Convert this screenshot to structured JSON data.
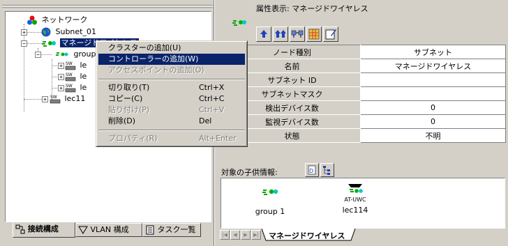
{
  "tree": {
    "root": "ネットワーク",
    "subnet": "Subnet_01",
    "managed_wireless": "マネージドワイヤレス",
    "group": "group",
    "le1": "le",
    "le2": "le",
    "le3": "le",
    "lec": "lec11"
  },
  "context_menu": {
    "items": [
      {
        "label": "クラスターの追加(U)",
        "shortcut": "",
        "state": "normal"
      },
      {
        "label": "コントローラーの追加(W)",
        "shortcut": "",
        "state": "highlighted"
      },
      {
        "label": "アクセスポイントの追加(O)",
        "shortcut": "",
        "state": "disabled"
      },
      {
        "label": "切り取り(T)",
        "shortcut": "Ctrl+X",
        "state": "normal"
      },
      {
        "label": "コピー(C)",
        "shortcut": "Ctrl+C",
        "state": "normal"
      },
      {
        "label": "貼り付け(P)",
        "shortcut": "Ctrl+V",
        "state": "disabled"
      },
      {
        "label": "削除(D)",
        "shortcut": "Del",
        "state": "normal"
      },
      {
        "label": "プロパティ(R)",
        "shortcut": "Alt+Enter",
        "state": "disabled"
      }
    ]
  },
  "left_tabs": [
    "接続構成",
    "VLAN 構成",
    "タスク一覧"
  ],
  "attributes": {
    "title": "属性表示: マネージドワイヤレス",
    "rows": [
      {
        "key": "ノード種別",
        "value": "サブネット"
      },
      {
        "key": "名前",
        "value": "マネージドワイヤレス"
      },
      {
        "key": "サブネット ID",
        "value": ""
      },
      {
        "key": "サブネットマスク",
        "value": ""
      },
      {
        "key": "検出デバイス数",
        "value": "0"
      },
      {
        "key": "監視デバイス数",
        "value": "0"
      },
      {
        "key": "状態",
        "value": "不明"
      }
    ]
  },
  "children": {
    "label": "対象の子供情報:",
    "items": [
      {
        "name": "group 1",
        "badge": ""
      },
      {
        "name": "lec114",
        "badge": "AT-UWC"
      }
    ]
  },
  "right_tab": "マネージドワイヤレス",
  "colors": {
    "face": "#d4d0c8",
    "selection": "#0a246a",
    "icon_green": "#00a000",
    "icon_cyan": "#00c0c0"
  }
}
